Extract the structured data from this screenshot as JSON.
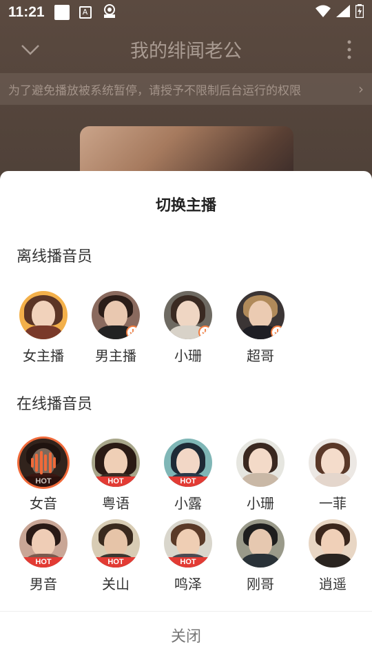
{
  "status_bar": {
    "time": "11:21"
  },
  "header": {
    "title": "我的绯闻老公"
  },
  "notice": {
    "text": "为了避免播放被系统暂停，请授予不限制后台运行的权限"
  },
  "sheet": {
    "title": "切换主播",
    "offline_section": "离线播音员",
    "online_section": "在线播音员",
    "close_label": "关闭"
  },
  "offline_anchors": [
    {
      "name": "女主播"
    },
    {
      "name": "男主播"
    },
    {
      "name": "小珊"
    },
    {
      "name": "超哥"
    }
  ],
  "online_anchors": [
    {
      "name": "女音",
      "badge": "HOT",
      "selected": true
    },
    {
      "name": "粤语",
      "badge": "HOT"
    },
    {
      "name": "小露",
      "badge": "HOT"
    },
    {
      "name": "小珊"
    },
    {
      "name": "一菲"
    },
    {
      "name": "男音",
      "badge": "HOT"
    },
    {
      "name": "关山",
      "badge": "HOT"
    },
    {
      "name": "鸣泽",
      "badge": "HOT"
    },
    {
      "name": "刚哥"
    },
    {
      "name": "逍遥"
    }
  ],
  "colors": {
    "accent": "#f06a3a",
    "hot_badge": "#e23b34"
  }
}
